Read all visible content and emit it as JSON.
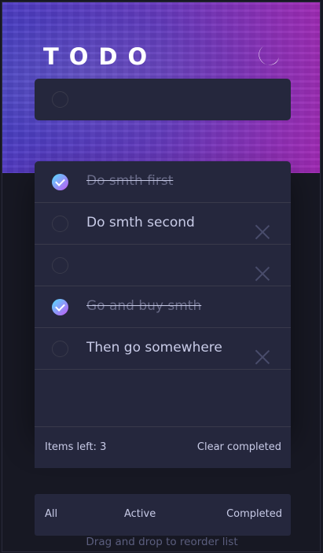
{
  "app": {
    "title": "TODO",
    "theme_toggle_icon": "moon-icon"
  },
  "new_todo": {
    "value": "",
    "placeholder": ""
  },
  "todos": [
    {
      "text": "Do smth first",
      "completed": true
    },
    {
      "text": "Do smth second",
      "completed": false
    },
    {
      "text": "",
      "completed": false
    },
    {
      "text": "Go and buy smth",
      "completed": true
    },
    {
      "text": "Then go somewhere",
      "completed": false
    }
  ],
  "footer": {
    "items_left": "Items left: 3",
    "clear_completed": "Clear completed"
  },
  "filters": {
    "all": "All",
    "active": "Active",
    "completed": "Completed"
  },
  "hint": "Drag and drop to reorder list",
  "colors": {
    "check_gradient_start": "#55ddff",
    "check_gradient_end": "#c058f3",
    "card_bg": "#25273d",
    "page_bg": "#171823"
  }
}
